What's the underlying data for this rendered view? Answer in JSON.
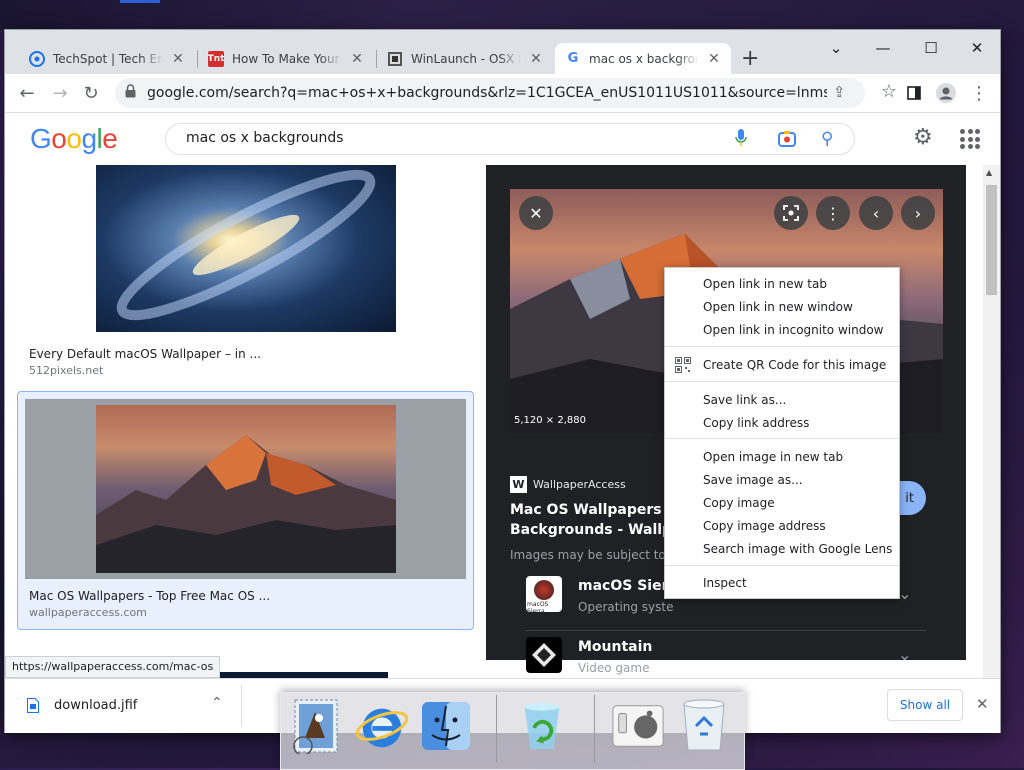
{
  "tabs": [
    {
      "title": "TechSpot | Tech Enthu",
      "icon": "techspot-icon",
      "active": false
    },
    {
      "title": "How To Make Your W",
      "icon": "tnt-icon",
      "active": false
    },
    {
      "title": "WinLaunch - OSX Lau",
      "icon": "winlaunch-icon",
      "active": false
    },
    {
      "title": "mac os x backgrounds",
      "icon": "google-icon",
      "active": true
    }
  ],
  "address_bar": {
    "url": "google.com/search?q=mac+os+x+backgrounds&rlz=1C1GCEA_enUS1011US1011&source=lnms&tbm=isc..."
  },
  "google": {
    "logo": "Google",
    "query": "mac os x backgrounds"
  },
  "results": [
    {
      "caption": "Every Default macOS Wallpaper – in ...",
      "source": "512pixels.net"
    },
    {
      "caption": "Mac OS Wallpapers - Top Free Mac OS ...",
      "source": "wallpaperaccess.com"
    }
  ],
  "preview": {
    "dimensions": "5,120 × 2,880",
    "site": "WallpaperAccess",
    "title_line1": "Mac OS Wallpapers - To",
    "title_line2": "Backgrounds - Wallpap",
    "notice": "Images may be subject to c",
    "visit_label": "it",
    "related": [
      {
        "title": "macOS Sierra",
        "subtitle": "Operating syste",
        "thumb_text": "macOS Sierra"
      },
      {
        "title": "Mountain",
        "subtitle": "Video game"
      }
    ]
  },
  "context_menu": {
    "group1": [
      "Open link in new tab",
      "Open link in new window",
      "Open link in incognito window"
    ],
    "qr": "Create QR Code for this image",
    "group2": [
      "Save link as...",
      "Copy link address"
    ],
    "group3": [
      "Open image in new tab",
      "Save image as...",
      "Copy image",
      "Copy image address",
      "Search image with Google Lens"
    ],
    "inspect": "Inspect"
  },
  "status_url": "https://wallpaperaccess.com/mac-os",
  "downloads": {
    "file": "download.jfif",
    "show_all": "Show all"
  },
  "colors": {
    "chrome_tabbar": "#dee1e6",
    "google_blue": "#4285f4",
    "google_red": "#ea4335",
    "google_yellow": "#fbbc05",
    "google_green": "#34a853",
    "panel_bg": "#202124"
  }
}
